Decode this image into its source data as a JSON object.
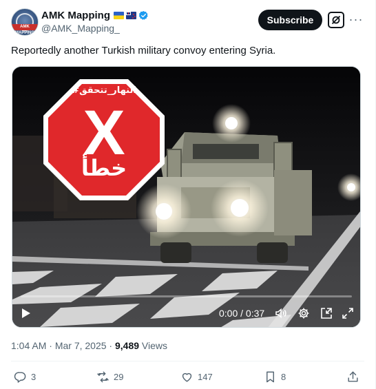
{
  "author": {
    "display_name": "AMK Mapping",
    "handle": "@AMK_Mapping_",
    "avatar_text": "AMK MAPPING"
  },
  "header": {
    "subscribe_label": "Subscribe",
    "more_label": "···"
  },
  "tweet": {
    "text": "Reportedly another Turkish military convoy entering Syria."
  },
  "media": {
    "stamp_hashtag": "#النهار_تتحقق",
    "stamp_mark": "X",
    "stamp_word": "خطأ",
    "time_display": "0:00 / 0:37",
    "progress": 0
  },
  "meta": {
    "time": "1:04 AM",
    "separator1": " · ",
    "date": "Mar 7, 2025",
    "separator2": " · ",
    "views_count": "9,489",
    "views_label": " Views"
  },
  "actions": {
    "replies": "3",
    "reposts": "29",
    "likes": "147",
    "bookmarks": "8"
  },
  "colors": {
    "brand": "#0f1419",
    "secondary_text": "#536471",
    "verified_blue": "#1d9bf0",
    "stamp_red": "#e0282b"
  }
}
